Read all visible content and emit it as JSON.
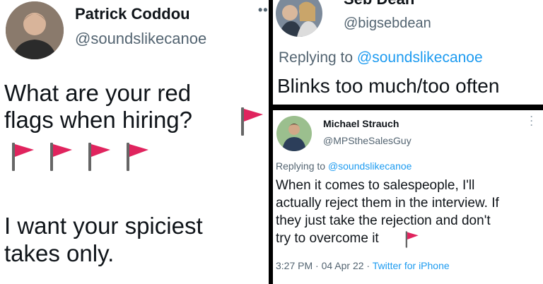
{
  "tweet_main": {
    "name": "Patrick Coddou",
    "handle": "@soundslikecanoe",
    "line1": "What are your red",
    "line2": "flags when hiring?",
    "line4": "I want your spiciest",
    "line5": "takes only."
  },
  "tweet_top_right": {
    "name": "Seb Dean",
    "handle": "@bigsebdean",
    "replying_prefix": "Replying to ",
    "replying_handle": "@soundslikecanoe",
    "text": "Blinks too much/too often"
  },
  "tweet_bottom_right": {
    "name": "Michael Strauch",
    "handle": "@MPStheSalesGuy",
    "replying_prefix": "Replying to ",
    "replying_handle": "@soundslikecanoe",
    "lines": [
      "When it comes to salespeople, I'll",
      "actually reject them in the interview. If",
      "they just take the rejection and don't",
      "try to overcome it"
    ],
    "timestamp": "3:27 PM · 04 Apr 22 · ",
    "source": "Twitter for iPhone",
    "more_icon": "vertical-dots-icon"
  },
  "icons": {
    "flag": "red-flag-icon"
  },
  "colors": {
    "link": "#1d9bf0",
    "flag": "#e0245e",
    "muted": "#536471"
  }
}
